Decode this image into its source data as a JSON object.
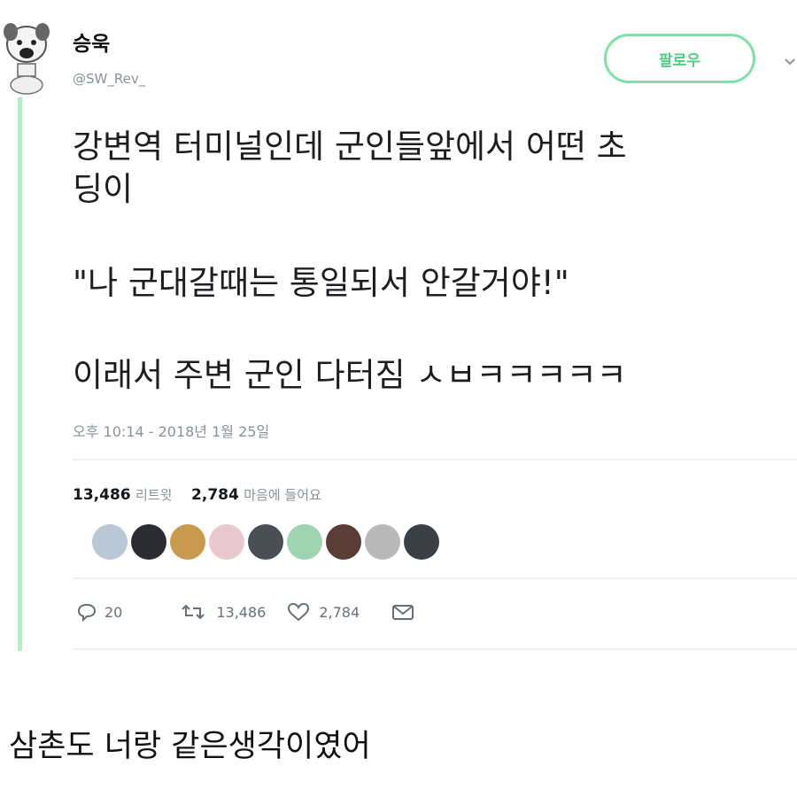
{
  "tweet": {
    "display_name": "승욱",
    "handle": "@SW_Rev_",
    "follow_label": "팔로우",
    "text_lines": [
      "강변역 터미널인데 군인들앞에서 어떤 초",
      "딩이",
      "\"나 군대갈때는 통일되서 안갈거야!\"",
      "이래서 주변 군인 다터짐 ㅅㅂㅋㅋㅋㅋㅋ"
    ],
    "timestamp": "오후 10:14 - 2018년 1월 25일",
    "stats": {
      "retweets_count": "13,486",
      "retweets_label": "리트윗",
      "likes_count": "2,784",
      "likes_label": "마음에 들어요"
    },
    "likers": [
      {
        "icon": "liker-avatar",
        "color": "#b9c7d6"
      },
      {
        "icon": "liker-avatar",
        "color": "#2b2b33"
      },
      {
        "icon": "liker-avatar",
        "color": "#c79a4e"
      },
      {
        "icon": "liker-avatar",
        "color": "#e9c9cf"
      },
      {
        "icon": "liker-avatar",
        "color": "#4a4e55"
      },
      {
        "icon": "liker-avatar",
        "color": "#9fd3b0"
      },
      {
        "icon": "liker-avatar",
        "color": "#5a3d36"
      },
      {
        "icon": "liker-avatar",
        "color": "#b9b9b9"
      },
      {
        "icon": "liker-avatar",
        "color": "#3b3f46"
      }
    ],
    "actions": {
      "reply_count": "20",
      "retweet_count": "13,486",
      "like_count": "2,784"
    },
    "colors": {
      "accent": "#4fcf82",
      "thread_line": "#b8ecc4",
      "muted": "#8a9299"
    }
  },
  "caption": "삼촌도 너랑 같은생각이였어"
}
